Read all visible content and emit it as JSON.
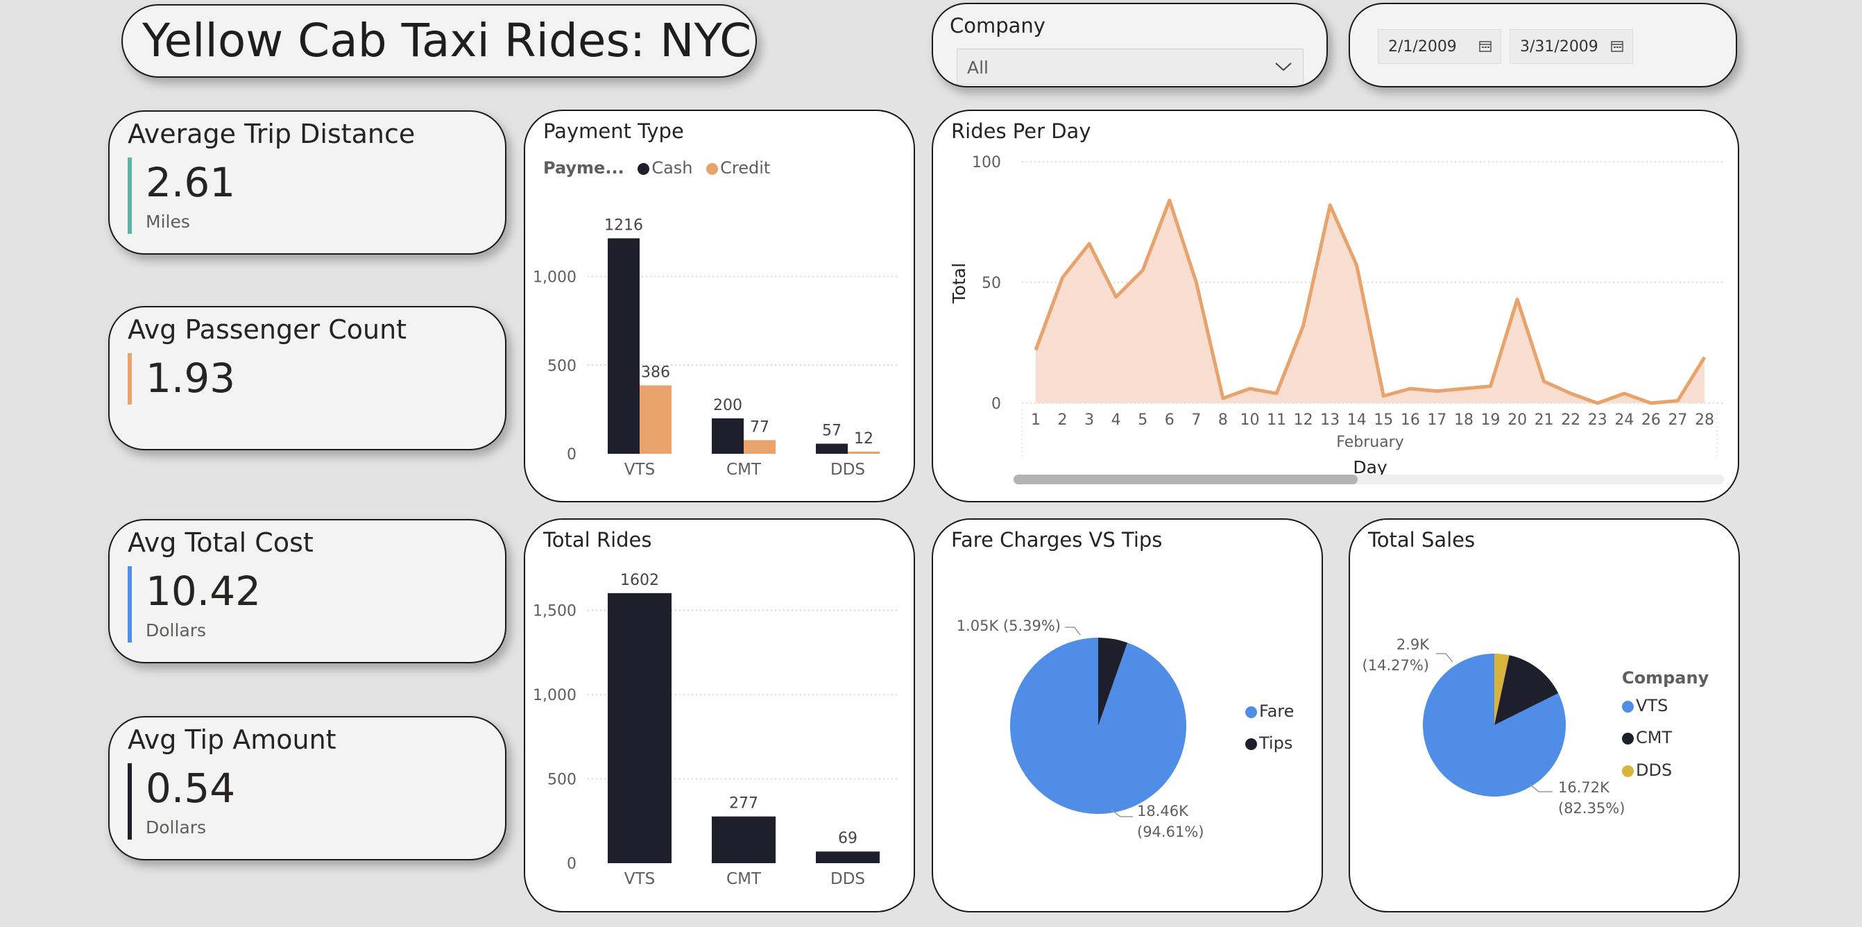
{
  "title": "Yellow Cab Taxi Rides: NYC",
  "filters": {
    "company_label": "Company",
    "company_value": "All",
    "start_date": "2/1/2009",
    "end_date": "3/31/2009"
  },
  "kpis": [
    {
      "title": "Average Trip Distance",
      "value": "2.61",
      "unit": "Miles",
      "color": "#5fb3a3"
    },
    {
      "title": "Avg Passenger Count",
      "value": "1.93",
      "unit": "",
      "color": "#e8a36c"
    },
    {
      "title": "Avg Total Cost",
      "value": "10.42",
      "unit": "Dollars",
      "color": "#4f8de6"
    },
    {
      "title": "Avg Tip Amount",
      "value": "0.54",
      "unit": "Dollars",
      "color": "#1f1f2b"
    }
  ],
  "colors": {
    "dark": "#1f1f2b",
    "orange": "#e8a36c",
    "blue": "#4f8de6",
    "gold": "#d8b43e"
  },
  "chart_data": [
    {
      "id": "payment",
      "type": "bar",
      "title": "Payment Type",
      "legend_title": "Payme...",
      "categories": [
        "VTS",
        "CMT",
        "DDS"
      ],
      "series": [
        {
          "name": "Cash",
          "values": [
            1216,
            200,
            57
          ]
        },
        {
          "name": "Credit",
          "values": [
            386,
            77,
            12
          ]
        }
      ],
      "ylim": [
        0,
        1300
      ],
      "yticks": [
        "0",
        "500",
        "1,000"
      ],
      "grid": true,
      "legend": "top-left"
    },
    {
      "id": "rides_per_day",
      "type": "area",
      "title": "Rides Per Day",
      "xlabel": "Day",
      "xsublabel": "February",
      "ylabel": "Total",
      "x": [
        "1",
        "2",
        "3",
        "4",
        "5",
        "6",
        "7",
        "8",
        "10",
        "11",
        "12",
        "13",
        "14",
        "15",
        "16",
        "17",
        "18",
        "19",
        "20",
        "21",
        "22",
        "23",
        "24",
        "26",
        "27",
        "28"
      ],
      "values": [
        22,
        52,
        66,
        44,
        55,
        84,
        50,
        2,
        6,
        4,
        32,
        82,
        57,
        3,
        6,
        5,
        6,
        7,
        43,
        9,
        4,
        0,
        4,
        0,
        1,
        19
      ],
      "ylim": [
        0,
        100
      ],
      "yticks": [
        "0",
        "50",
        "100"
      ],
      "grid": true
    },
    {
      "id": "total_rides",
      "type": "bar",
      "title": "Total Rides",
      "categories": [
        "VTS",
        "CMT",
        "DDS"
      ],
      "series": [
        {
          "name": "",
          "values": [
            1602,
            277,
            69
          ]
        }
      ],
      "ylim": [
        0,
        1700
      ],
      "yticks": [
        "0",
        "500",
        "1,000",
        "1,500"
      ],
      "grid": true
    },
    {
      "id": "fare_tips",
      "type": "pie",
      "title": "Fare Charges VS Tips",
      "slices": [
        {
          "name": "Fare",
          "value": 18460,
          "pct": 94.61,
          "label1": "18.46K",
          "label2": "(94.61%)"
        },
        {
          "name": "Tips",
          "value": 1050,
          "pct": 5.39,
          "label1": "1.05K (5.39%)",
          "label2": ""
        }
      ],
      "legend": "right"
    },
    {
      "id": "total_sales",
      "type": "pie",
      "title": "Total Sales",
      "legend_title": "Company",
      "slices": [
        {
          "name": "VTS",
          "value": 16720,
          "pct": 82.35,
          "label1": "16.72K",
          "label2": "(82.35%)"
        },
        {
          "name": "CMT",
          "value": 2900,
          "pct": 14.27,
          "label1": "2.9K",
          "label2": "(14.27%)"
        },
        {
          "name": "DDS",
          "value": 680,
          "pct": 3.38,
          "label1": "",
          "label2": ""
        }
      ],
      "legend": "right"
    }
  ]
}
